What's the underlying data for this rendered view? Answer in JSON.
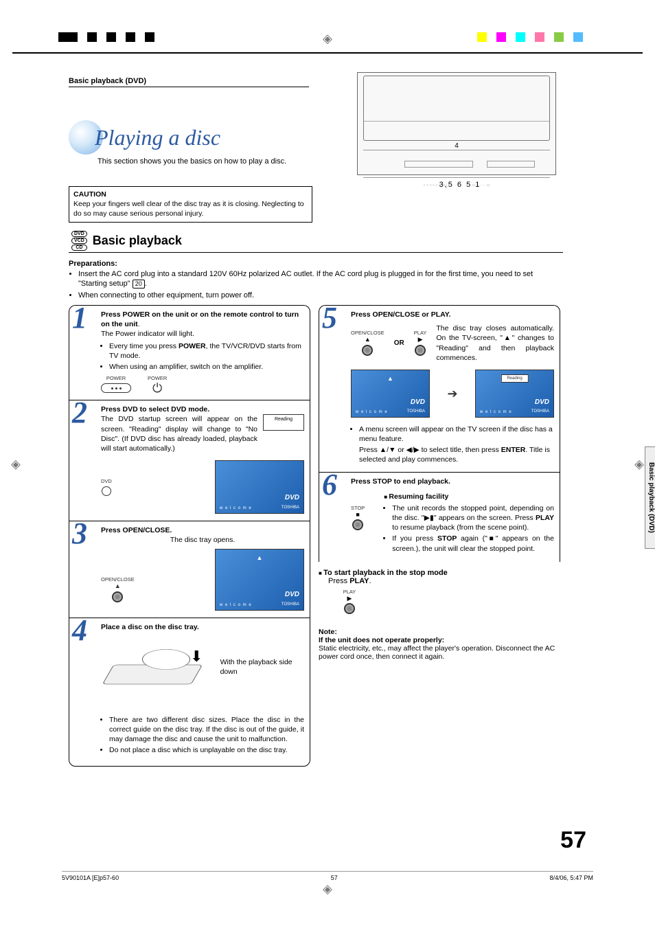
{
  "header": {
    "section": "Basic playback (DVD)"
  },
  "title": {
    "main": "Playing a disc",
    "sub": "This section shows you the basics on how to play a disc."
  },
  "device_callouts": {
    "top": "4",
    "bottom": "3,5   6 5   1"
  },
  "caution": {
    "heading": "CAUTION",
    "body": "Keep your fingers well clear of the disc tray as it is closing. Neglecting to do so may cause serious personal injury."
  },
  "basic": {
    "heading": "Basic playback"
  },
  "badges": [
    "DVD",
    "VCD",
    "CD"
  ],
  "prep": {
    "heading": "Preparations:",
    "p1a": "Insert the AC cord plug into a standard 120V 60Hz polarized AC outlet. If the AC cord plug is plugged in for the first time, you need to set \"Starting setup\" ",
    "p1ref": "20",
    "p1b": ".",
    "p2": "When connecting to other equipment, turn power off."
  },
  "steps": {
    "1": {
      "head": "Press POWER on the unit or on the remote control to turn on the unit",
      "line": "The Power indicator will light.",
      "b1a": "Every time you press ",
      "b1pow": "POWER",
      "b1b": ", the TV/VCR/DVD starts from TV mode.",
      "b2": "When using an amplifier, switch on the amplifier.",
      "lbl_unit": "POWER",
      "lbl_remote": "POWER"
    },
    "2": {
      "head": "Press DVD to select DVD mode.",
      "body": "The DVD startup screen will appear on the screen. \"Reading\" display will change to \"No Disc\". (If DVD disc has already loaded, playback will start automatically.)",
      "lbl_btn": "DVD",
      "reading": "Reading",
      "logo": "DVD",
      "brand": "TOSHIBA",
      "welcome": "w e l c o m e"
    },
    "3": {
      "head": "Press OPEN/CLOSE.",
      "line": "The disc tray opens.",
      "lbl_btn": "OPEN/CLOSE"
    },
    "4": {
      "head": "Place a disc on the disc tray.",
      "side": "With the playback side down",
      "b1": "There are two different disc sizes. Place the disc in the correct guide on the disc tray. If the disc is out of the guide, it may damage the disc and cause the unit to malfunction.",
      "b2": "Do not place a disc which is unplayable on the disc tray."
    },
    "5": {
      "head": "Press OPEN/CLOSE or PLAY.",
      "lbl_open": "OPEN/CLOSE",
      "lbl_play": "PLAY",
      "or": "OR",
      "body": "The disc tray closes automatically. On the TV-screen, \"▲\" changes to \"Reading\" and then playback commences.",
      "reading": "Reading",
      "m1": "A menu screen will appear on the TV screen if the disc has a menu feature.",
      "m2a": "Press ▲/▼ or ◀/▶ to select title, then press ",
      "m2enter": "ENTER",
      "m2b": ". Title is selected and play commences."
    },
    "6": {
      "head": "Press STOP to end playback.",
      "lbl_btn": "STOP",
      "resume_h": "Resuming facility",
      "r1a": "The unit records the stopped point, depending on the disc. \"▶▮\" appears on the screen. Press ",
      "r1play": "PLAY",
      "r1b": " to resume playback (from the scene point).",
      "r2a": "If you press ",
      "r2stop": "STOP",
      "r2b": " again (\"■\" appears on the screen.), the unit will clear the stopped point."
    },
    "restart": {
      "head": "To start playback in the stop mode",
      "body_a": "Press ",
      "body_play": "PLAY",
      "body_b": ".",
      "lbl_btn": "PLAY"
    }
  },
  "note": {
    "h": "Note:",
    "sub": "If the unit does not operate properly:",
    "body": "Static electricity, etc., may affect the player's operation. Disconnect the AC power cord once, then connect it again."
  },
  "side_tab": "Basic playback (DVD)",
  "page_number": "57",
  "footer": {
    "left": "5V90101A [E]p57-60",
    "center": "57",
    "right": "8/4/06, 5:47 PM"
  }
}
